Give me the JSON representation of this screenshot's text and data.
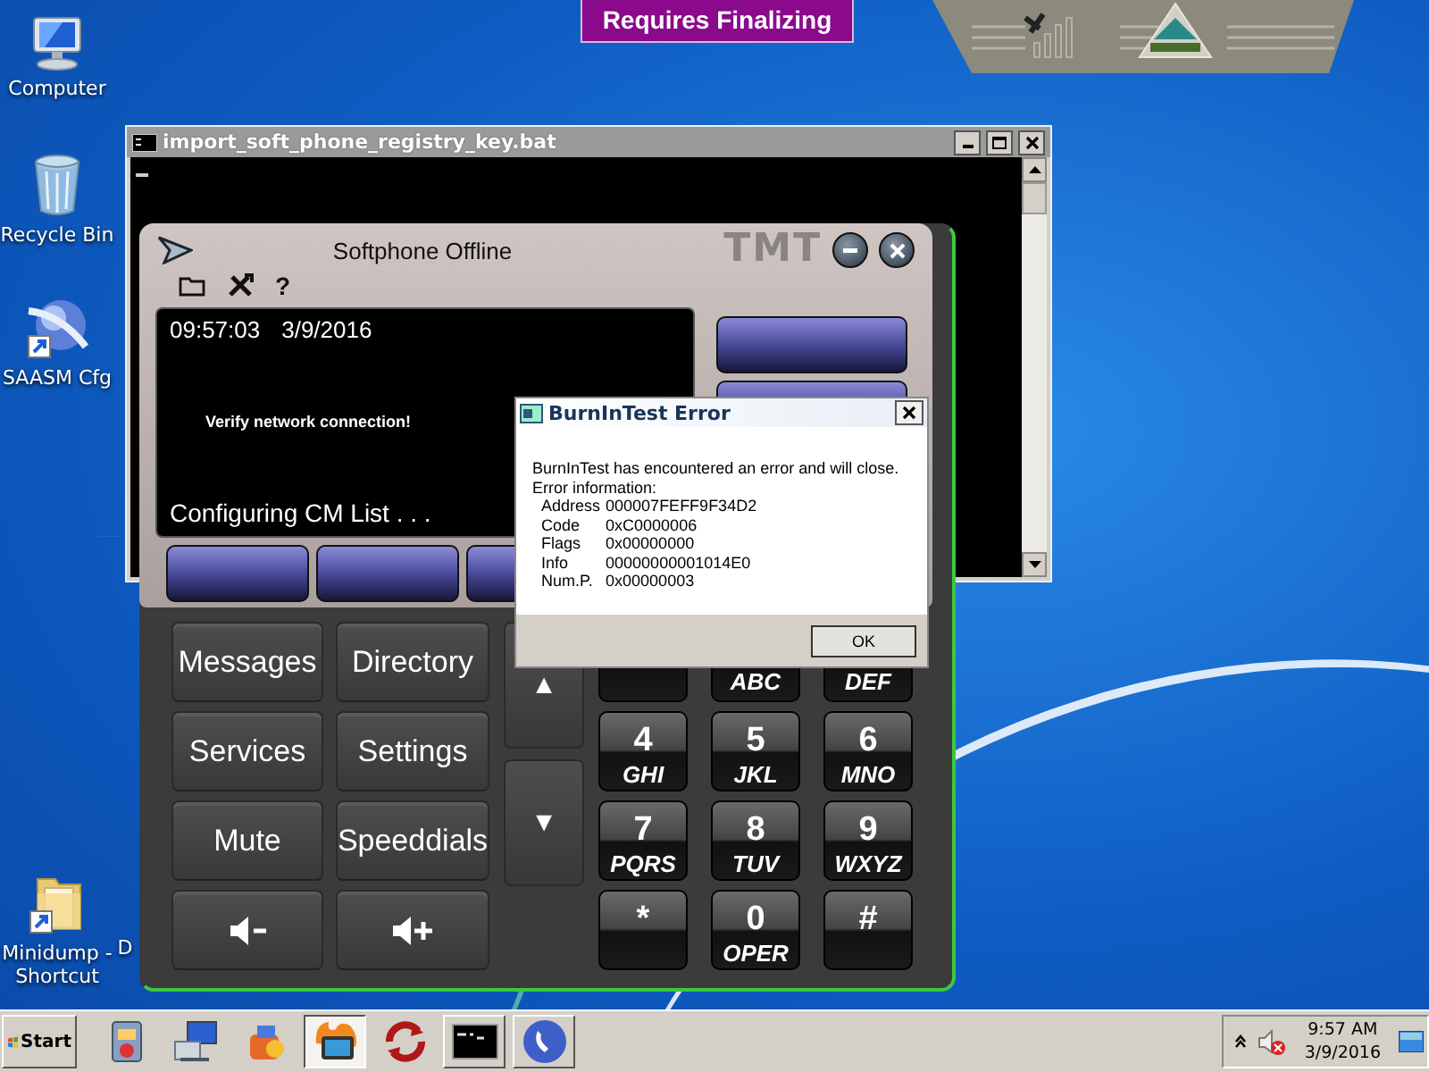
{
  "desktop_icons": [
    {
      "label": "Computer",
      "kind": "computer"
    },
    {
      "label": "Recycle Bin",
      "kind": "recycle"
    },
    {
      "label": "SAASM Cfg",
      "kind": "globe"
    },
    {
      "label": "Minidump - Shortcut",
      "kind": "folder"
    },
    {
      "label": "D",
      "kind": "partial"
    }
  ],
  "banner": {
    "label": "Requires Finalizing"
  },
  "console_window": {
    "title": "import_soft_phone_registry_key.bat"
  },
  "softphone": {
    "title": "Softphone Offline",
    "logo": "TMT",
    "toolbar": [
      {
        "kind": "folder"
      },
      {
        "kind": "tools"
      },
      {
        "kind": "glyph",
        "text": "?"
      }
    ],
    "display": {
      "time": "09:57:03",
      "date": "3/9/2016",
      "message": "Verify network connection!",
      "status": "Configuring CM List . . ."
    },
    "function_keys": [
      {
        "kind": "text",
        "label": "Messages"
      },
      {
        "kind": "text",
        "label": "Directory"
      },
      {
        "kind": "text",
        "label": "Services"
      },
      {
        "kind": "text",
        "label": "Settings"
      },
      {
        "kind": "text",
        "label": "Mute"
      },
      {
        "kind": "text",
        "label": "Speeddials"
      },
      {
        "kind": "volume-down"
      },
      {
        "kind": "volume-up"
      }
    ],
    "nav_keys": [
      "▲",
      "▼"
    ],
    "keypad": [
      {
        "kind": "blank"
      },
      {
        "kind": "key",
        "letters": "ABC"
      },
      {
        "kind": "key",
        "letters": "DEF"
      },
      {
        "kind": "key",
        "digit": "4",
        "letters": "GHI"
      },
      {
        "kind": "key",
        "digit": "5",
        "letters": "JKL"
      },
      {
        "kind": "key",
        "digit": "6",
        "letters": "MNO"
      },
      {
        "kind": "key",
        "digit": "7",
        "letters": "PQRS"
      },
      {
        "kind": "key",
        "digit": "8",
        "letters": "TUV"
      },
      {
        "kind": "key",
        "digit": "9",
        "letters": "WXYZ"
      },
      {
        "kind": "key",
        "digit": "*"
      },
      {
        "kind": "key",
        "digit": "0",
        "letters": "OPER"
      },
      {
        "kind": "key",
        "digit": "#"
      }
    ]
  },
  "dialog": {
    "title": "BurnInTest Error",
    "message": "BurnInTest has encountered an error and will close.",
    "info_heading": "Error information:",
    "fields": [
      {
        "label": "Address",
        "value": "000007FEFF9F34D2"
      },
      {
        "label": "Code",
        "value": "0xC0000006"
      },
      {
        "label": "Flags",
        "value": "0x00000000"
      },
      {
        "label": "Info",
        "value": "00000000001014E0"
      },
      {
        "label": "Num.P.",
        "value": "0x00000003"
      }
    ],
    "button": "OK"
  },
  "taskbar": {
    "start": "Start",
    "apps": [
      {
        "kind": "panel",
        "selected": false,
        "running": false
      },
      {
        "kind": "network",
        "selected": false,
        "running": false
      },
      {
        "kind": "flask",
        "selected": false,
        "running": false
      },
      {
        "kind": "burn",
        "selected": true,
        "running": true
      },
      {
        "kind": "sync",
        "selected": false,
        "running": false
      },
      {
        "kind": "console",
        "selected": false,
        "running": true
      },
      {
        "kind": "phone",
        "selected": false,
        "running": true
      }
    ],
    "clock_time": "9:57 AM",
    "clock_date": "3/9/2016"
  }
}
